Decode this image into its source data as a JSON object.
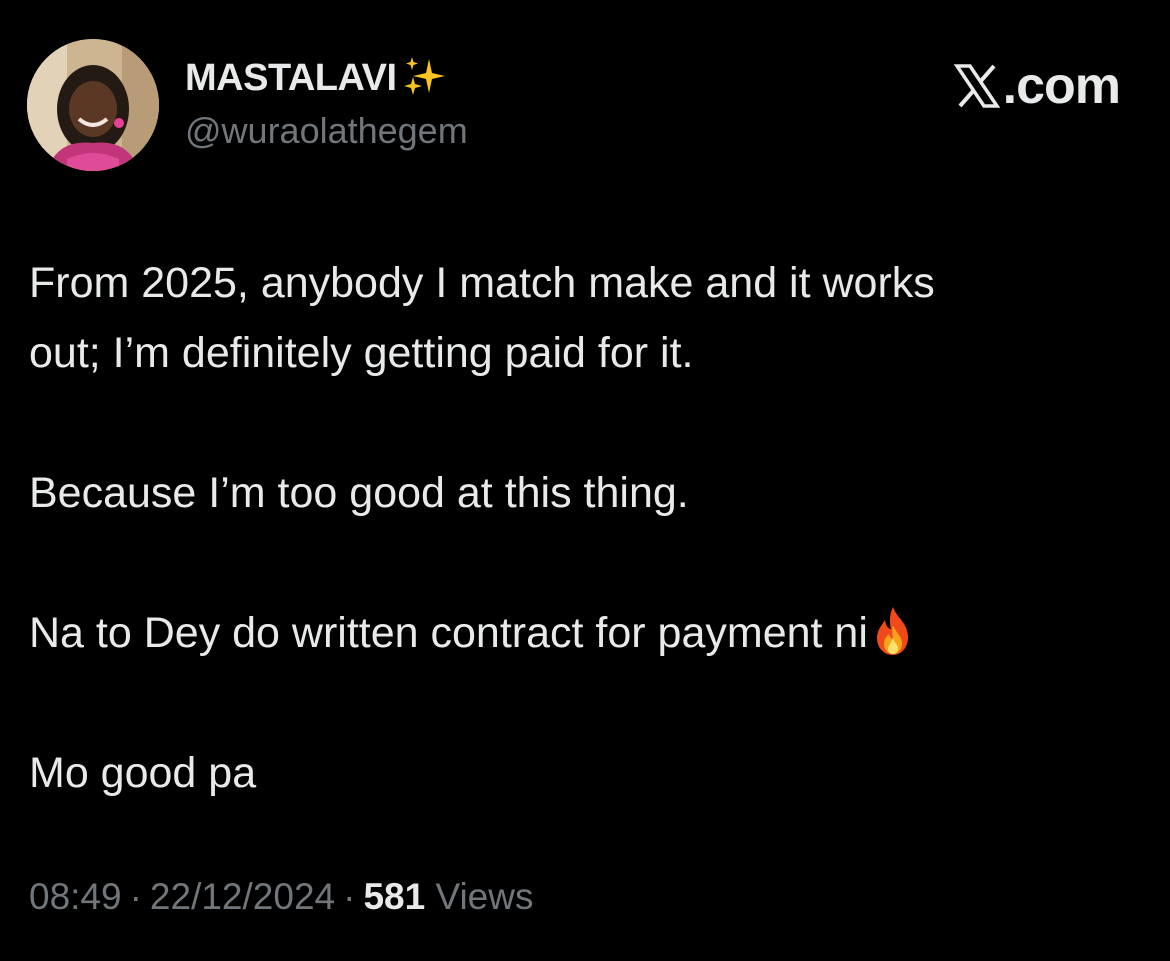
{
  "author": {
    "display_name": "MASTALAVI",
    "handle": "@wuraolathegem",
    "avatar_icon": "profile-photo",
    "badge_icon": "sparkles-emoji"
  },
  "brand": {
    "icon": "x-logo-icon",
    "text": ".com"
  },
  "tweet": {
    "lines": [
      "From 2025, anybody I match make and it works",
      "out; I’m definitely getting paid for it.",
      "Because I’m too good at this thing.",
      "Na to Dey do written contract for payment ni",
      "Mo good pa"
    ],
    "emoji_icon": "fire-emoji"
  },
  "meta": {
    "time": "08:49",
    "date": "22/12/2024",
    "views_count": "581",
    "views_label": "Views",
    "separator": "·"
  },
  "colors": {
    "background": "#000000",
    "primary_text": "#e7e9ea",
    "secondary_text": "#71767b"
  }
}
